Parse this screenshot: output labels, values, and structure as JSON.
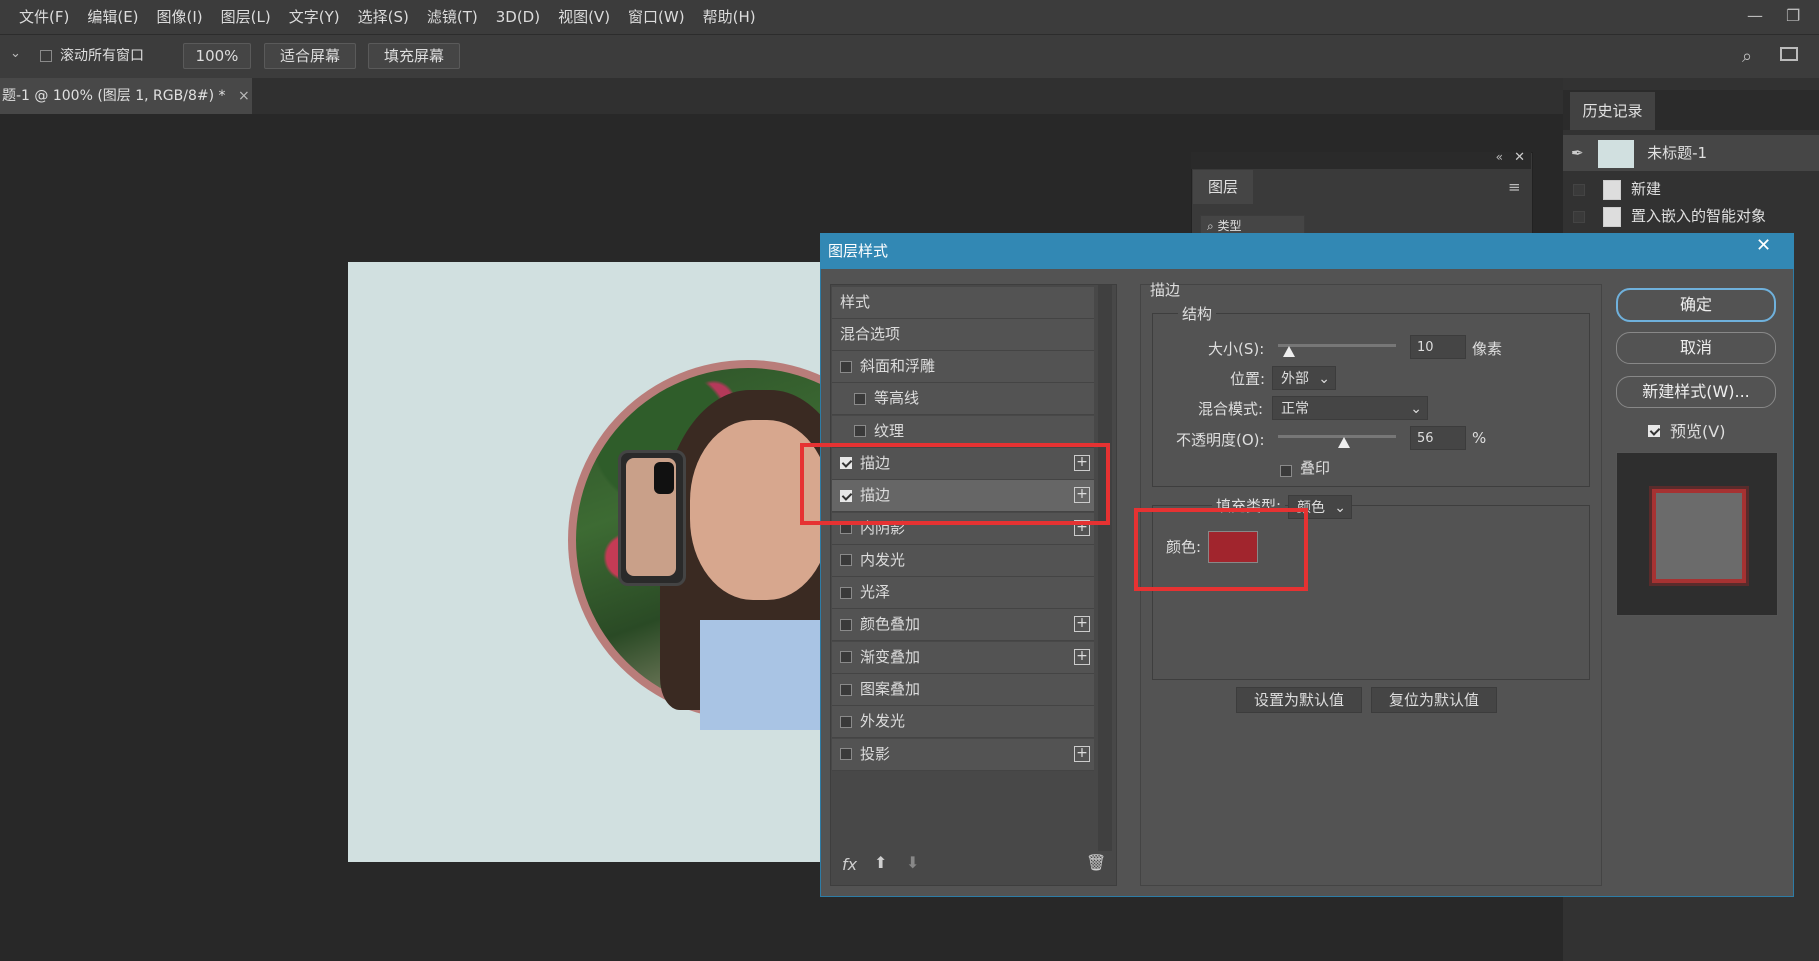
{
  "menu": [
    "文件(F)",
    "编辑(E)",
    "图像(I)",
    "图层(L)",
    "文字(Y)",
    "选择(S)",
    "滤镜(T)",
    "3D(D)",
    "视图(V)",
    "窗口(W)",
    "帮助(H)"
  ],
  "options": {
    "scroll_all_label": "滚动所有窗口",
    "zoom": "100%",
    "fit_screen": "适合屏幕",
    "fill_screen": "填充屏幕"
  },
  "doc_tab": {
    "title": "题-1 @ 100% (图层 1, RGB/8#) *",
    "close": "×"
  },
  "history": {
    "tab": "历史记录",
    "snapshot": "未标题-1",
    "items": [
      "新建",
      "置入嵌入的智能对象"
    ]
  },
  "layers_panel": {
    "tab": "图层",
    "search": "类型"
  },
  "dialog": {
    "title": "图层样式",
    "style_header": "样式",
    "blend_options": "混合选项",
    "styles": [
      {
        "label": "斜面和浮雕",
        "checked": false,
        "plus": false,
        "indent": false
      },
      {
        "label": "等高线",
        "checked": false,
        "plus": false,
        "indent": true
      },
      {
        "label": "纹理",
        "checked": false,
        "plus": false,
        "indent": true
      },
      {
        "label": "描边",
        "checked": true,
        "plus": true,
        "indent": false
      },
      {
        "label": "描边",
        "checked": true,
        "plus": true,
        "indent": false,
        "selected": true
      },
      {
        "label": "内阴影",
        "checked": false,
        "plus": true,
        "indent": false
      },
      {
        "label": "内发光",
        "checked": false,
        "plus": false,
        "indent": false
      },
      {
        "label": "光泽",
        "checked": false,
        "plus": false,
        "indent": false
      },
      {
        "label": "颜色叠加",
        "checked": false,
        "plus": true,
        "indent": false
      },
      {
        "label": "渐变叠加",
        "checked": false,
        "plus": true,
        "indent": false
      },
      {
        "label": "图案叠加",
        "checked": false,
        "plus": false,
        "indent": false
      },
      {
        "label": "外发光",
        "checked": false,
        "plus": false,
        "indent": false
      },
      {
        "label": "投影",
        "checked": false,
        "plus": true,
        "indent": false
      }
    ],
    "stroke": {
      "section": "描边",
      "structure": "结构",
      "size_label": "大小(S):",
      "size_value": "10",
      "size_unit": "像素",
      "position_label": "位置:",
      "position_value": "外部",
      "blend_label": "混合模式:",
      "blend_value": "正常",
      "opacity_label": "不透明度(O):",
      "opacity_value": "56",
      "opacity_unit": "%",
      "overprint_label": "叠印",
      "fill_type_label": "填充类型:",
      "fill_type_value": "颜色",
      "color_label": "颜色:",
      "color_hex": "#a1252d",
      "set_default": "设置为默认值",
      "reset_default": "复位为默认值"
    },
    "buttons": {
      "ok": "确定",
      "cancel": "取消",
      "new_style": "新建样式(W)...",
      "preview": "预览(V)"
    },
    "fx": "fx"
  }
}
